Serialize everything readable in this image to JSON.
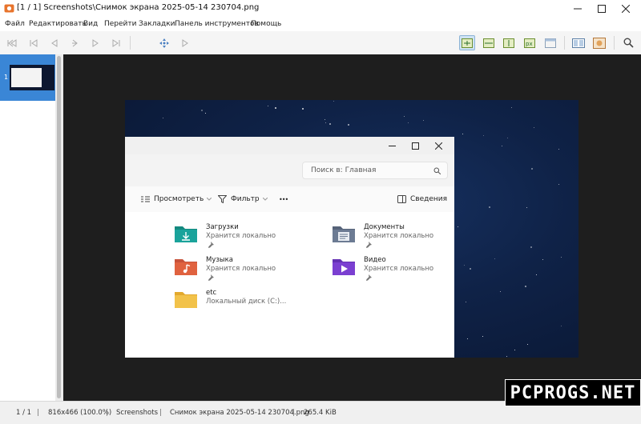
{
  "window": {
    "title": "[1 / 1]  Screenshots\\Снимок экрана 2025-05-14 230704.png"
  },
  "menu": [
    "Файл",
    "Редактировать",
    "Вид",
    "Перейти",
    "Закладки",
    "Панель инструментов",
    "Помощь"
  ],
  "toolbar": {
    "nav_icons": [
      "first-page-icon",
      "previous-folder-icon",
      "previous-icon",
      "rotate-icon",
      "next-icon",
      "last-page-icon",
      "move-icon",
      "play-icon"
    ],
    "view_icons": [
      "fit-window-icon",
      "fit-width-icon",
      "fit-height-icon",
      "actual-size-icon",
      "blank-icon",
      "dual-page-icon",
      "manga-icon",
      "search-icon"
    ],
    "active_view": "fit-window-icon"
  },
  "sidebar": {
    "thumbnails": [
      {
        "number": "1",
        "selected": true
      }
    ]
  },
  "explorer": {
    "search_placeholder": "Поиск в: Главная",
    "commands": {
      "view_label": "Просмотреть",
      "filter_label": "Фильтр",
      "more_label": "•••",
      "details_label": "Сведения"
    },
    "folders": [
      {
        "name": "Загрузки",
        "sub": "Хранится локально",
        "pinned": true,
        "icon": "downloads-folder-icon",
        "color": "#1aa39b"
      },
      {
        "name": "Документы",
        "sub": "Хранится локально",
        "pinned": true,
        "icon": "documents-folder-icon",
        "color": "#6c7b93"
      },
      {
        "name": "Музыка",
        "sub": "Хранится локально",
        "pinned": true,
        "icon": "music-folder-icon",
        "color": "#e0623f"
      },
      {
        "name": "Видео",
        "sub": "Хранится локально",
        "pinned": true,
        "icon": "video-folder-icon",
        "color": "#7b3fd1"
      },
      {
        "name": "etc",
        "sub": "Локальный диск (C:)...",
        "pinned": false,
        "icon": "folder-icon",
        "color": "#f2c24a"
      }
    ]
  },
  "status": {
    "page": "1 / 1",
    "size": "816x466 (100.0%)",
    "folder": "Screenshots",
    "file": "Снимок экрана 2025-05-14 230704.png",
    "filesize": "265.4 KiB",
    "separator": "|"
  },
  "watermark": "PCPROGS.NET",
  "colors": {
    "selection": "#3a86d6",
    "viewer_bg": "#1e1e1e",
    "space": "#0f2247",
    "toolbar_active": "#cfe3f3"
  }
}
